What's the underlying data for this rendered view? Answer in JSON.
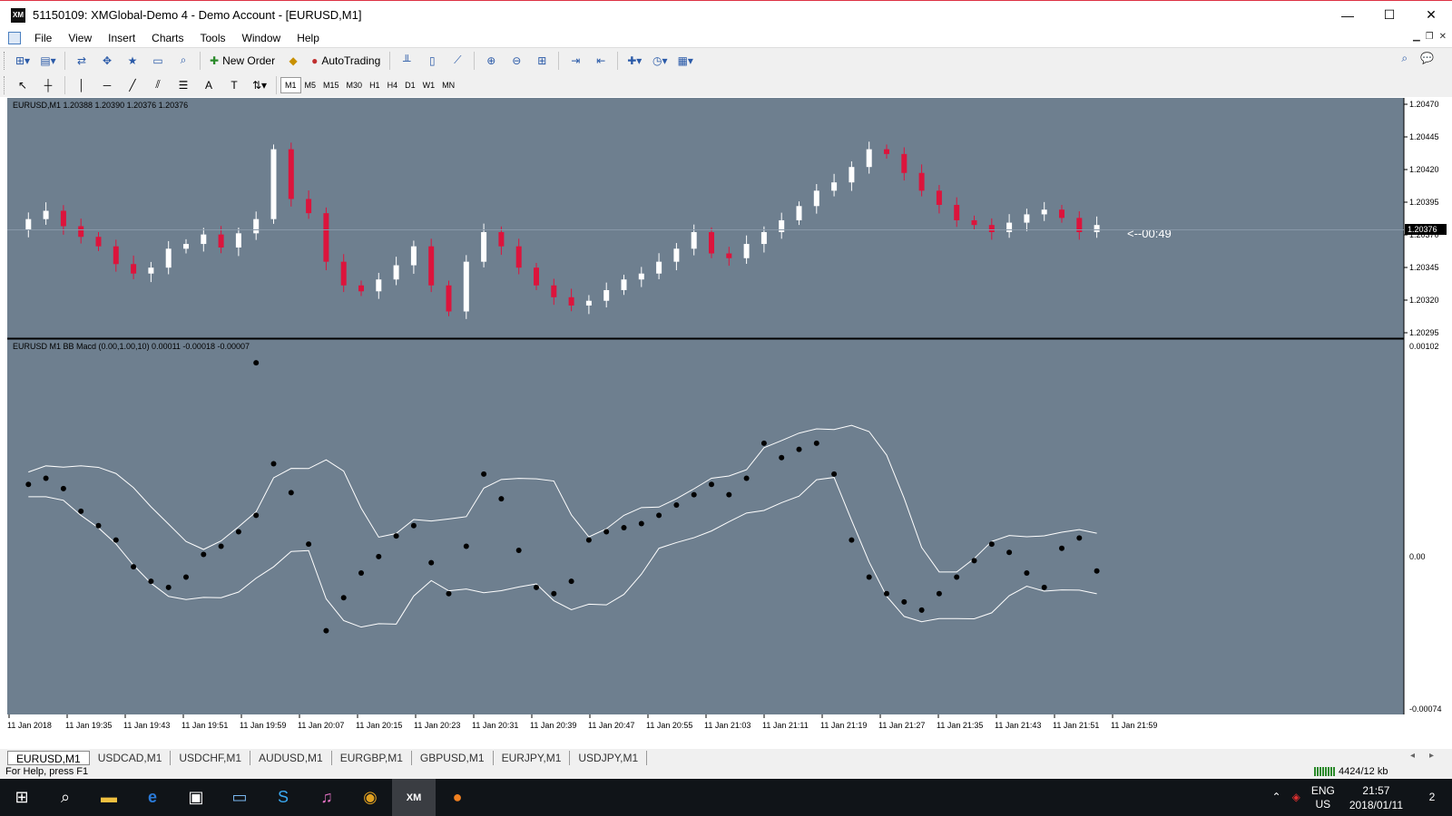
{
  "window": {
    "title": "51150109: XMGlobal-Demo 4 - Demo Account - [EURUSD,M1]",
    "logo_text": "XM",
    "minimize": "—",
    "maximize": "☐",
    "close": "✕"
  },
  "menu": [
    "File",
    "View",
    "Insert",
    "Charts",
    "Tools",
    "Window",
    "Help"
  ],
  "toolbar": {
    "new_order": "New Order",
    "auto_trading": "AutoTrading"
  },
  "timeframes": [
    "M1",
    "M5",
    "M15",
    "M30",
    "H1",
    "H4",
    "D1",
    "W1",
    "MN"
  ],
  "active_timeframe": "M1",
  "chart": {
    "bg_color": "#6e7f8f",
    "up_color": "#ffffff",
    "down_color": "#dc143c",
    "main_label": "EURUSD,M1  1.20388 1.20390 1.20376 1.20376",
    "indicator_label": "EURUSD M1 BB Macd (0.00,1.00,10) 0.00011 -0.00018 -0.00007",
    "countdown": "<--00:49",
    "current_price": "1.20376",
    "price_axis": [
      "1.20470",
      "1.20445",
      "1.20420",
      "1.20395",
      "1.20370",
      "1.20345",
      "1.20320",
      "1.20295"
    ],
    "indicator_axis": [
      "0.00102",
      "0.00",
      "-0.00074"
    ],
    "time_axis": [
      "11 Jan 2018",
      "11 Jan 19:35",
      "11 Jan 19:43",
      "11 Jan 19:51",
      "11 Jan 19:59",
      "11 Jan 20:07",
      "11 Jan 20:15",
      "11 Jan 20:23",
      "11 Jan 20:31",
      "11 Jan 20:39",
      "11 Jan 20:47",
      "11 Jan 20:55",
      "11 Jan 21:03",
      "11 Jan 21:11",
      "11 Jan 21:19",
      "11 Jan 21:27",
      "11 Jan 21:35",
      "11 Jan 21:43",
      "11 Jan 21:51",
      "11 Jan 21:59"
    ]
  },
  "chart_data": {
    "type": "candlestick",
    "symbol": "EURUSD",
    "timeframe": "M1",
    "price_ylim": [
      1.20285,
      1.20478
    ],
    "indicator_ylim": [
      -0.00074,
      0.00102
    ],
    "close_path": [
      1.20372,
      1.20381,
      1.20388,
      1.20375,
      1.20366,
      1.20358,
      1.20343,
      1.20335,
      1.2034,
      1.20356,
      1.2036,
      1.20368,
      1.20357,
      1.20369,
      1.20381,
      1.2044,
      1.20398,
      1.20386,
      1.20345,
      1.20325,
      1.2032,
      1.2033,
      1.20342,
      1.20358,
      1.20325,
      1.20303,
      1.20345,
      1.2037,
      1.20358,
      1.2034,
      1.20325,
      1.20315,
      1.20308,
      1.20312,
      1.20321,
      1.2033,
      1.20335,
      1.20345,
      1.20356,
      1.2037,
      1.20352,
      1.20348,
      1.2036,
      1.2037,
      1.2038,
      1.20392,
      1.20405,
      1.20412,
      1.20425,
      1.2044,
      1.20436,
      1.2042,
      1.20405,
      1.20393,
      1.2038,
      1.20376,
      1.2037,
      1.20378,
      1.20385,
      1.20389,
      1.20382,
      1.2037,
      1.20376
    ],
    "bb_macd_dots": [
      0.00035,
      0.00038,
      0.00033,
      0.00022,
      0.00015,
      8e-05,
      -5e-05,
      -0.00012,
      -0.00015,
      -0.0001,
      1e-05,
      5e-05,
      0.00012,
      0.0002,
      0.00045,
      0.00031,
      6e-05,
      -0.00036,
      -0.0002,
      -8e-05,
      0.0,
      0.0001,
      0.00015,
      -3e-05,
      -0.00018,
      5e-05,
      0.0004,
      0.00028,
      3e-05,
      -0.00015,
      -0.00018,
      -0.00012,
      8e-05,
      0.00012,
      0.00014,
      0.00016,
      0.0002,
      0.00025,
      0.0003,
      0.00035,
      0.0003,
      0.00038,
      0.00055,
      0.00048,
      0.00052,
      0.00055,
      0.0004,
      8e-05,
      -0.0001,
      -0.00018,
      -0.00022,
      -0.00026,
      -0.00018,
      -0.0001,
      -2e-05,
      6e-05,
      2e-05,
      -8e-05,
      -0.00015,
      4e-05,
      9e-05,
      -7e-05,
      0.00094
    ]
  },
  "tabs": [
    "EURUSD,M1",
    "USDCAD,M1",
    "USDCHF,M1",
    "AUDUSD,M1",
    "EURGBP,M1",
    "GBPUSD,M1",
    "EURJPY,M1",
    "USDJPY,M1"
  ],
  "active_tab": "EURUSD,M1",
  "status": {
    "help": "For Help, press F1",
    "connection": "4424/12 kb"
  },
  "taskbar": {
    "lang_top": "ENG",
    "lang_bottom": "US",
    "time": "21:57",
    "date": "2018/01/11",
    "notifications": "2"
  }
}
